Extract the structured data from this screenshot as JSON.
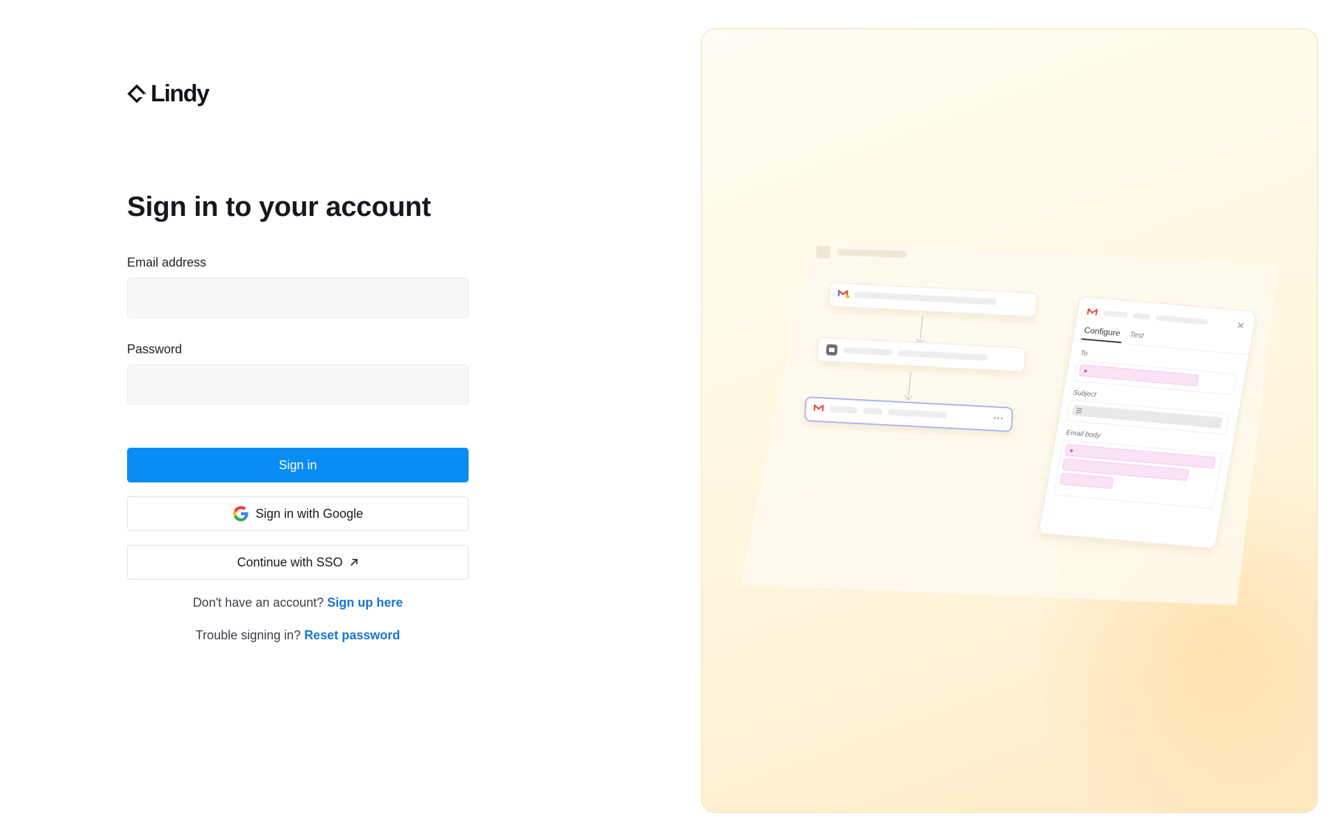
{
  "brand": {
    "name": "Lindy"
  },
  "signin": {
    "title": "Sign in to your account",
    "email_label": "Email address",
    "email_value": "",
    "password_label": "Password",
    "password_value": "",
    "submit_label": "Sign in",
    "google_label": "Sign in with Google",
    "sso_label": "Continue with SSO"
  },
  "footer": {
    "signup_prompt": "Don't have an account?",
    "signup_link": "Sign up here",
    "trouble_prompt": "Trouble signing in?",
    "reset_link": "Reset password"
  },
  "illustration": {
    "tabs": [
      "Configure",
      "Test"
    ],
    "fields": [
      "To",
      "Subject",
      "Email body"
    ]
  },
  "colors": {
    "primary": "#0a8cf5",
    "link": "#1576d6",
    "panel_border": "#f3dfa6",
    "panel_bg": "#fff6dc"
  },
  "icons": [
    "lindy-logo-icon",
    "google-icon",
    "external-arrow-icon",
    "gmail-icon",
    "close-icon",
    "sparkle-icon"
  ]
}
